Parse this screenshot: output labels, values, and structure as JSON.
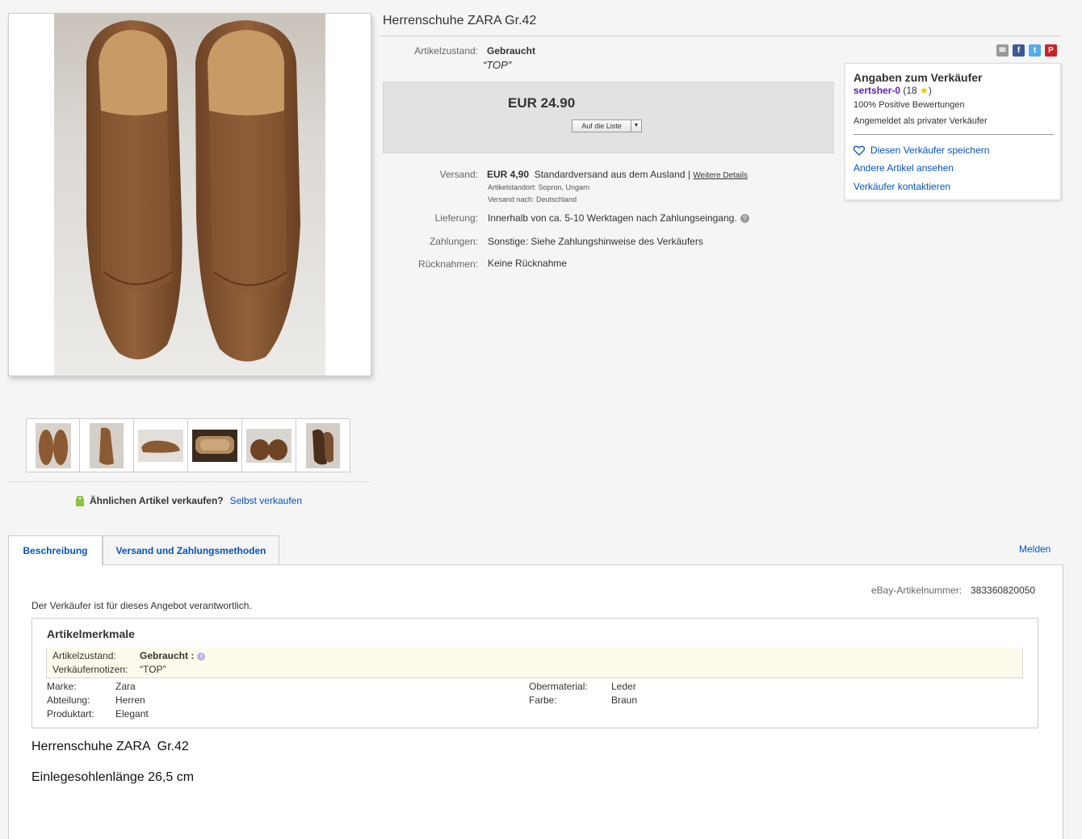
{
  "title": "Herrenschuhe ZARA Gr.42",
  "condition": {
    "label": "Artikelzustand:",
    "value": "Gebraucht",
    "note": "“TOP”"
  },
  "price": {
    "value": "EUR 24.90",
    "watch_label": "Auf die Liste"
  },
  "shipping": {
    "label": "Versand:",
    "cost": "EUR 4,90",
    "method": "Standardversand aus dem Ausland |",
    "details_link": "Weitere Details",
    "location": "Artikelstandort: Sopron, Ungarn",
    "ships_to": "Versand nach: Deutschland"
  },
  "delivery": {
    "label": "Lieferung:",
    "value": "Innerhalb von ca. 5-10 Werktagen nach Zahlungseingang."
  },
  "payments": {
    "label": "Zahlungen:",
    "value": "Sonstige: Siehe Zahlungshinweise des Verkäufers"
  },
  "returns": {
    "label": "Rücknahmen:",
    "value": "Keine Rücknahme"
  },
  "seller": {
    "heading": "Angaben zum Verkäufer",
    "username": "sertsher-0",
    "feedback_score": "(18",
    "feedback_close": ")",
    "positive": "100% Positive Bewertungen",
    "type": "Angemeldet als privater Verkäufer",
    "save_seller": "Diesen Verkäufer speichern",
    "other_items": "Andere Artikel ansehen",
    "contact": "Verkäufer kontaktieren"
  },
  "share_icons": [
    "mail-icon",
    "facebook-icon",
    "twitter-icon",
    "pinterest-icon"
  ],
  "sell_similar": {
    "question": "Ähnlichen Artikel verkaufen?",
    "link": "Selbst verkaufen"
  },
  "tabs": [
    {
      "label": "Beschreibung"
    },
    {
      "label": "Versand und Zahlungsmethoden"
    }
  ],
  "report_link": "Melden",
  "item_number": {
    "label": "eBay-Artikelnummer:",
    "value": "383360820050"
  },
  "seller_responsible": "Der Verkäufer ist für dieses Angebot verantwortlich.",
  "specifics": {
    "heading": "Artikelmerkmale",
    "condition_label": "Artikelzustand:",
    "condition_value": "Gebraucht :",
    "notes_label": "Verkäufernotizen:",
    "notes_value": "“TOP”",
    "left": [
      {
        "label": "Marke:",
        "value": "Zara"
      },
      {
        "label": "Abteilung:",
        "value": "Herren"
      },
      {
        "label": "Produktart:",
        "value": "Elegant"
      }
    ],
    "right": [
      {
        "label": "Obermaterial:",
        "value": "Leder"
      },
      {
        "label": "Farbe:",
        "value": "Braun"
      }
    ]
  },
  "description": {
    "line1": "Herrenschuhe ZARA  Gr.42",
    "line2": "Einlegesohlenlänge 26,5 cm"
  },
  "colors": {
    "link": "#0654ba",
    "username": "#5d1db5",
    "leather": "#8b5a32",
    "star": "#f2c200"
  }
}
